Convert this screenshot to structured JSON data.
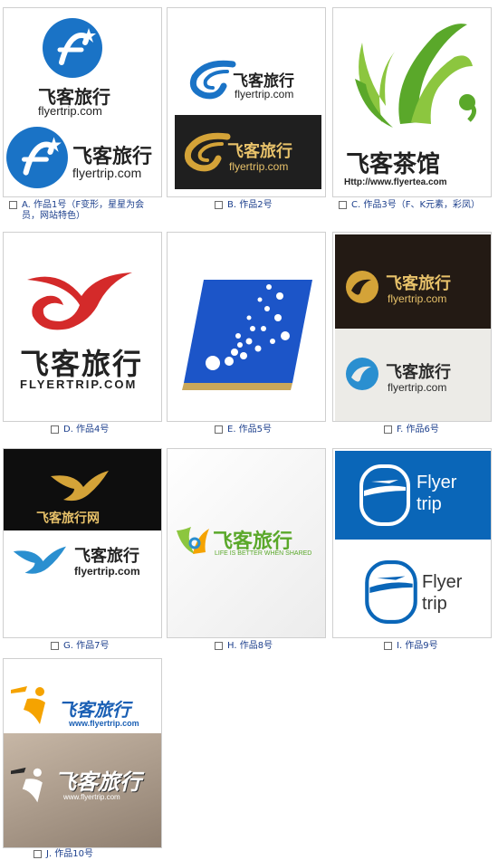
{
  "options": [
    {
      "label": "A. 作品1号（F变形，星星为会员，网站特色）",
      "selected": false
    },
    {
      "label": "B. 作品2号",
      "selected": false
    },
    {
      "label": "C. 作品3号（F、K元素，彩凤）",
      "selected": false
    },
    {
      "label": "D. 作品4号",
      "selected": false
    },
    {
      "label": "E. 作品5号",
      "selected": false
    },
    {
      "label": "F. 作品6号",
      "selected": false
    },
    {
      "label": "G. 作品7号",
      "selected": false
    },
    {
      "label": "H. 作品8号",
      "selected": false
    },
    {
      "label": "I. 作品9号",
      "selected": false
    },
    {
      "label": "J. 作品10号",
      "selected": false
    }
  ],
  "logos": {
    "brand_cn": "飞客旅行",
    "brand_url": "flyertrip.com",
    "brand_url_upper": "FLYERTRIP.COM",
    "brand_url_www": "www.flyertrip.com",
    "tea_cn": "飞客茶馆",
    "tea_url": "Http://www.flyertea.com",
    "brand_net": "飞客旅行网",
    "slogan": "LIFE IS BETTER WHEN SHARED",
    "flyer": "Flyer",
    "trip": "trip"
  },
  "colors": {
    "link_blue": "#1c3f8c",
    "brand_blue": "#1a73c6",
    "tea_green": "#5aa82a",
    "red": "#d42a2a",
    "gold": "#d4a338",
    "orange": "#f5a300",
    "dark_bg": "#1a1a1a",
    "icon_blue_bg": "#0a66b8"
  }
}
